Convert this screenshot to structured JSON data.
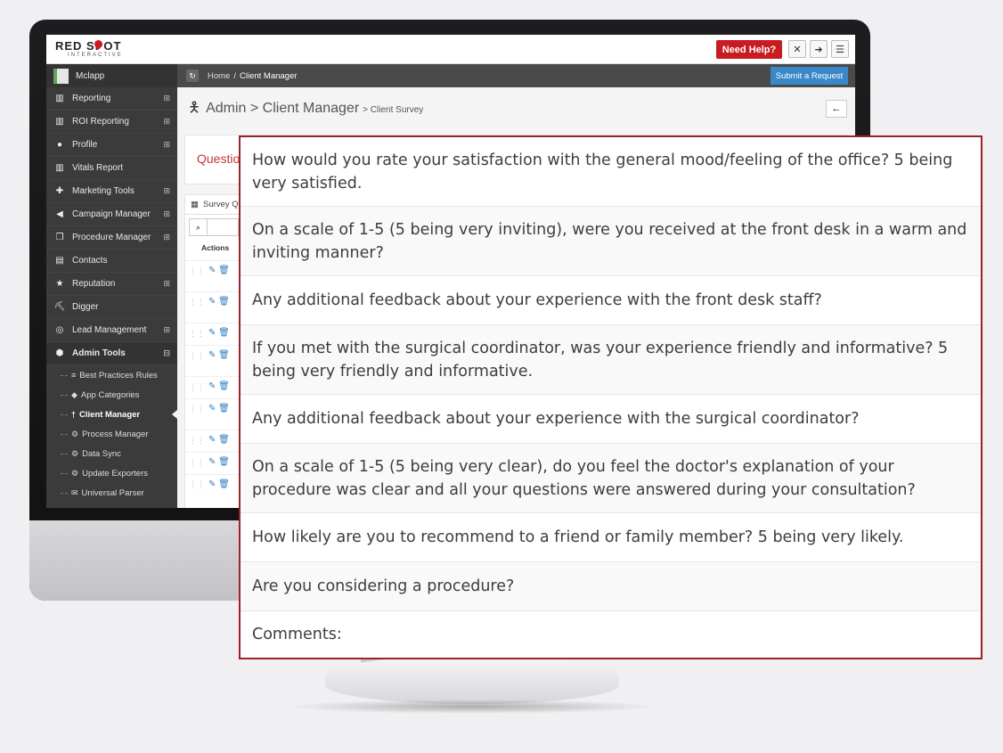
{
  "app": {
    "logo_top": "RED SPOT",
    "logo_bottom": "INTERACTIVE",
    "help_label": "Need Help?",
    "accent_color": "#c71c22"
  },
  "sidebar": {
    "user": "Mclapp",
    "items": [
      {
        "label": "Reporting",
        "icon": "bar-chart-icon",
        "expandable": true
      },
      {
        "label": "ROI Reporting",
        "icon": "bar-chart-icon",
        "expandable": true
      },
      {
        "label": "Profile",
        "icon": "user-icon",
        "expandable": true
      },
      {
        "label": "Vitals Report",
        "icon": "bar-chart-icon",
        "expandable": false
      },
      {
        "label": "Marketing Tools",
        "icon": "puzzle-icon",
        "expandable": true
      },
      {
        "label": "Campaign Manager",
        "icon": "megaphone-icon",
        "expandable": true
      },
      {
        "label": "Procedure Manager",
        "icon": "copy-icon",
        "expandable": true
      },
      {
        "label": "Contacts",
        "icon": "contact-card-icon",
        "expandable": false
      },
      {
        "label": "Reputation",
        "icon": "star-icon",
        "expandable": true
      },
      {
        "label": "Digger",
        "icon": "digger-icon",
        "expandable": false
      },
      {
        "label": "Lead Management",
        "icon": "headset-icon",
        "expandable": true
      },
      {
        "label": "Admin Tools",
        "icon": "cube-icon",
        "expandable": true
      }
    ],
    "sub_items": [
      {
        "label": "Best Practices Rules",
        "icon": "list-icon"
      },
      {
        "label": "App Categories",
        "icon": "tags-icon"
      },
      {
        "label": "Client Manager",
        "icon": "figure-icon"
      },
      {
        "label": "Process Manager",
        "icon": "cogs-icon"
      },
      {
        "label": "Data Sync",
        "icon": "cogs-icon"
      },
      {
        "label": "Update Exporters",
        "icon": "cogs-icon"
      },
      {
        "label": "Universal Parser",
        "icon": "envelope-icon"
      }
    ]
  },
  "breadcrumb": {
    "home": "Home",
    "sep": "/",
    "current": "Client Manager",
    "request_button": "Submit a Request"
  },
  "page": {
    "title_main": "Admin > Client Manager",
    "title_sub": "> Client Survey",
    "questions_heading": "Questio",
    "table_heading": "Survey Q",
    "actions_header": "Actions"
  },
  "questions": [
    "How would you rate your satisfaction with the general mood/feeling of the office? 5 being very satisfied.",
    "On a scale of 1-5 (5 being very inviting), were you received at the front desk in a warm and inviting manner?",
    "Any additional feedback about your experience with the front desk staff?",
    "If you met with the surgical coordinator, was your experience friendly and informative? 5 being very friendly and informative.",
    "Any additional feedback about your experience with the surgical coordinator?",
    "On a scale of 1-5 (5 being very clear), do you feel the doctor's explanation of your procedure was clear and all your questions were answered during your consultation?",
    "How likely are you to recommend to a friend or family member? 5 being very likely.",
    "Are you considering a procedure?",
    "Comments:"
  ]
}
